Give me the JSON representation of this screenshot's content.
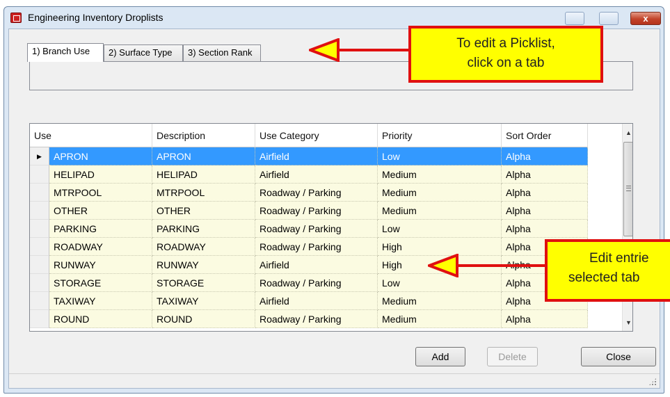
{
  "window": {
    "title": "Engineering Inventory Droplists",
    "close_glyph": "x",
    "accent": "#3399ff"
  },
  "tabs": [
    {
      "label": "1) Branch Use",
      "active": true
    },
    {
      "label": "2) Surface Type",
      "active": false
    },
    {
      "label": "3) Section Rank",
      "active": false
    }
  ],
  "grid": {
    "columns": [
      "Use",
      "Description",
      "Use Category",
      "Priority",
      "Sort Order"
    ],
    "rows": [
      [
        "APRON",
        "APRON",
        "Airfield",
        "Low",
        "Alpha"
      ],
      [
        "HELIPAD",
        "HELIPAD",
        "Airfield",
        "Medium",
        "Alpha"
      ],
      [
        "MTRPOOL",
        "MTRPOOL",
        "Roadway / Parking",
        "Medium",
        "Alpha"
      ],
      [
        "OTHER",
        "OTHER",
        "Roadway / Parking",
        "Medium",
        "Alpha"
      ],
      [
        "PARKING",
        "PARKING",
        "Roadway / Parking",
        "Low",
        "Alpha"
      ],
      [
        "ROADWAY",
        "ROADWAY",
        "Roadway / Parking",
        "High",
        "Alpha"
      ],
      [
        "RUNWAY",
        "RUNWAY",
        "Airfield",
        "High",
        "Alpha"
      ],
      [
        "STORAGE",
        "STORAGE",
        "Roadway / Parking",
        "Low",
        "Alpha"
      ],
      [
        "TAXIWAY",
        "TAXIWAY",
        "Airfield",
        "Medium",
        "Alpha"
      ],
      [
        "ROUND",
        "ROUND",
        "Roadway / Parking",
        "Medium",
        "Alpha"
      ]
    ],
    "selected_row": 0
  },
  "buttons": {
    "add": "Add",
    "delete": "Delete",
    "close": "Close"
  },
  "callouts": {
    "tabs_line1": "To edit a Picklist,",
    "tabs_line2": "click on a tab",
    "grid_line1": "Edit entrie",
    "grid_line2": "selected tab"
  },
  "colors": {
    "callout_fill": "#ffff00",
    "callout_border": "#e01010",
    "cell_fill": "#fbfbe1",
    "selected_fill": "#3399ff"
  }
}
